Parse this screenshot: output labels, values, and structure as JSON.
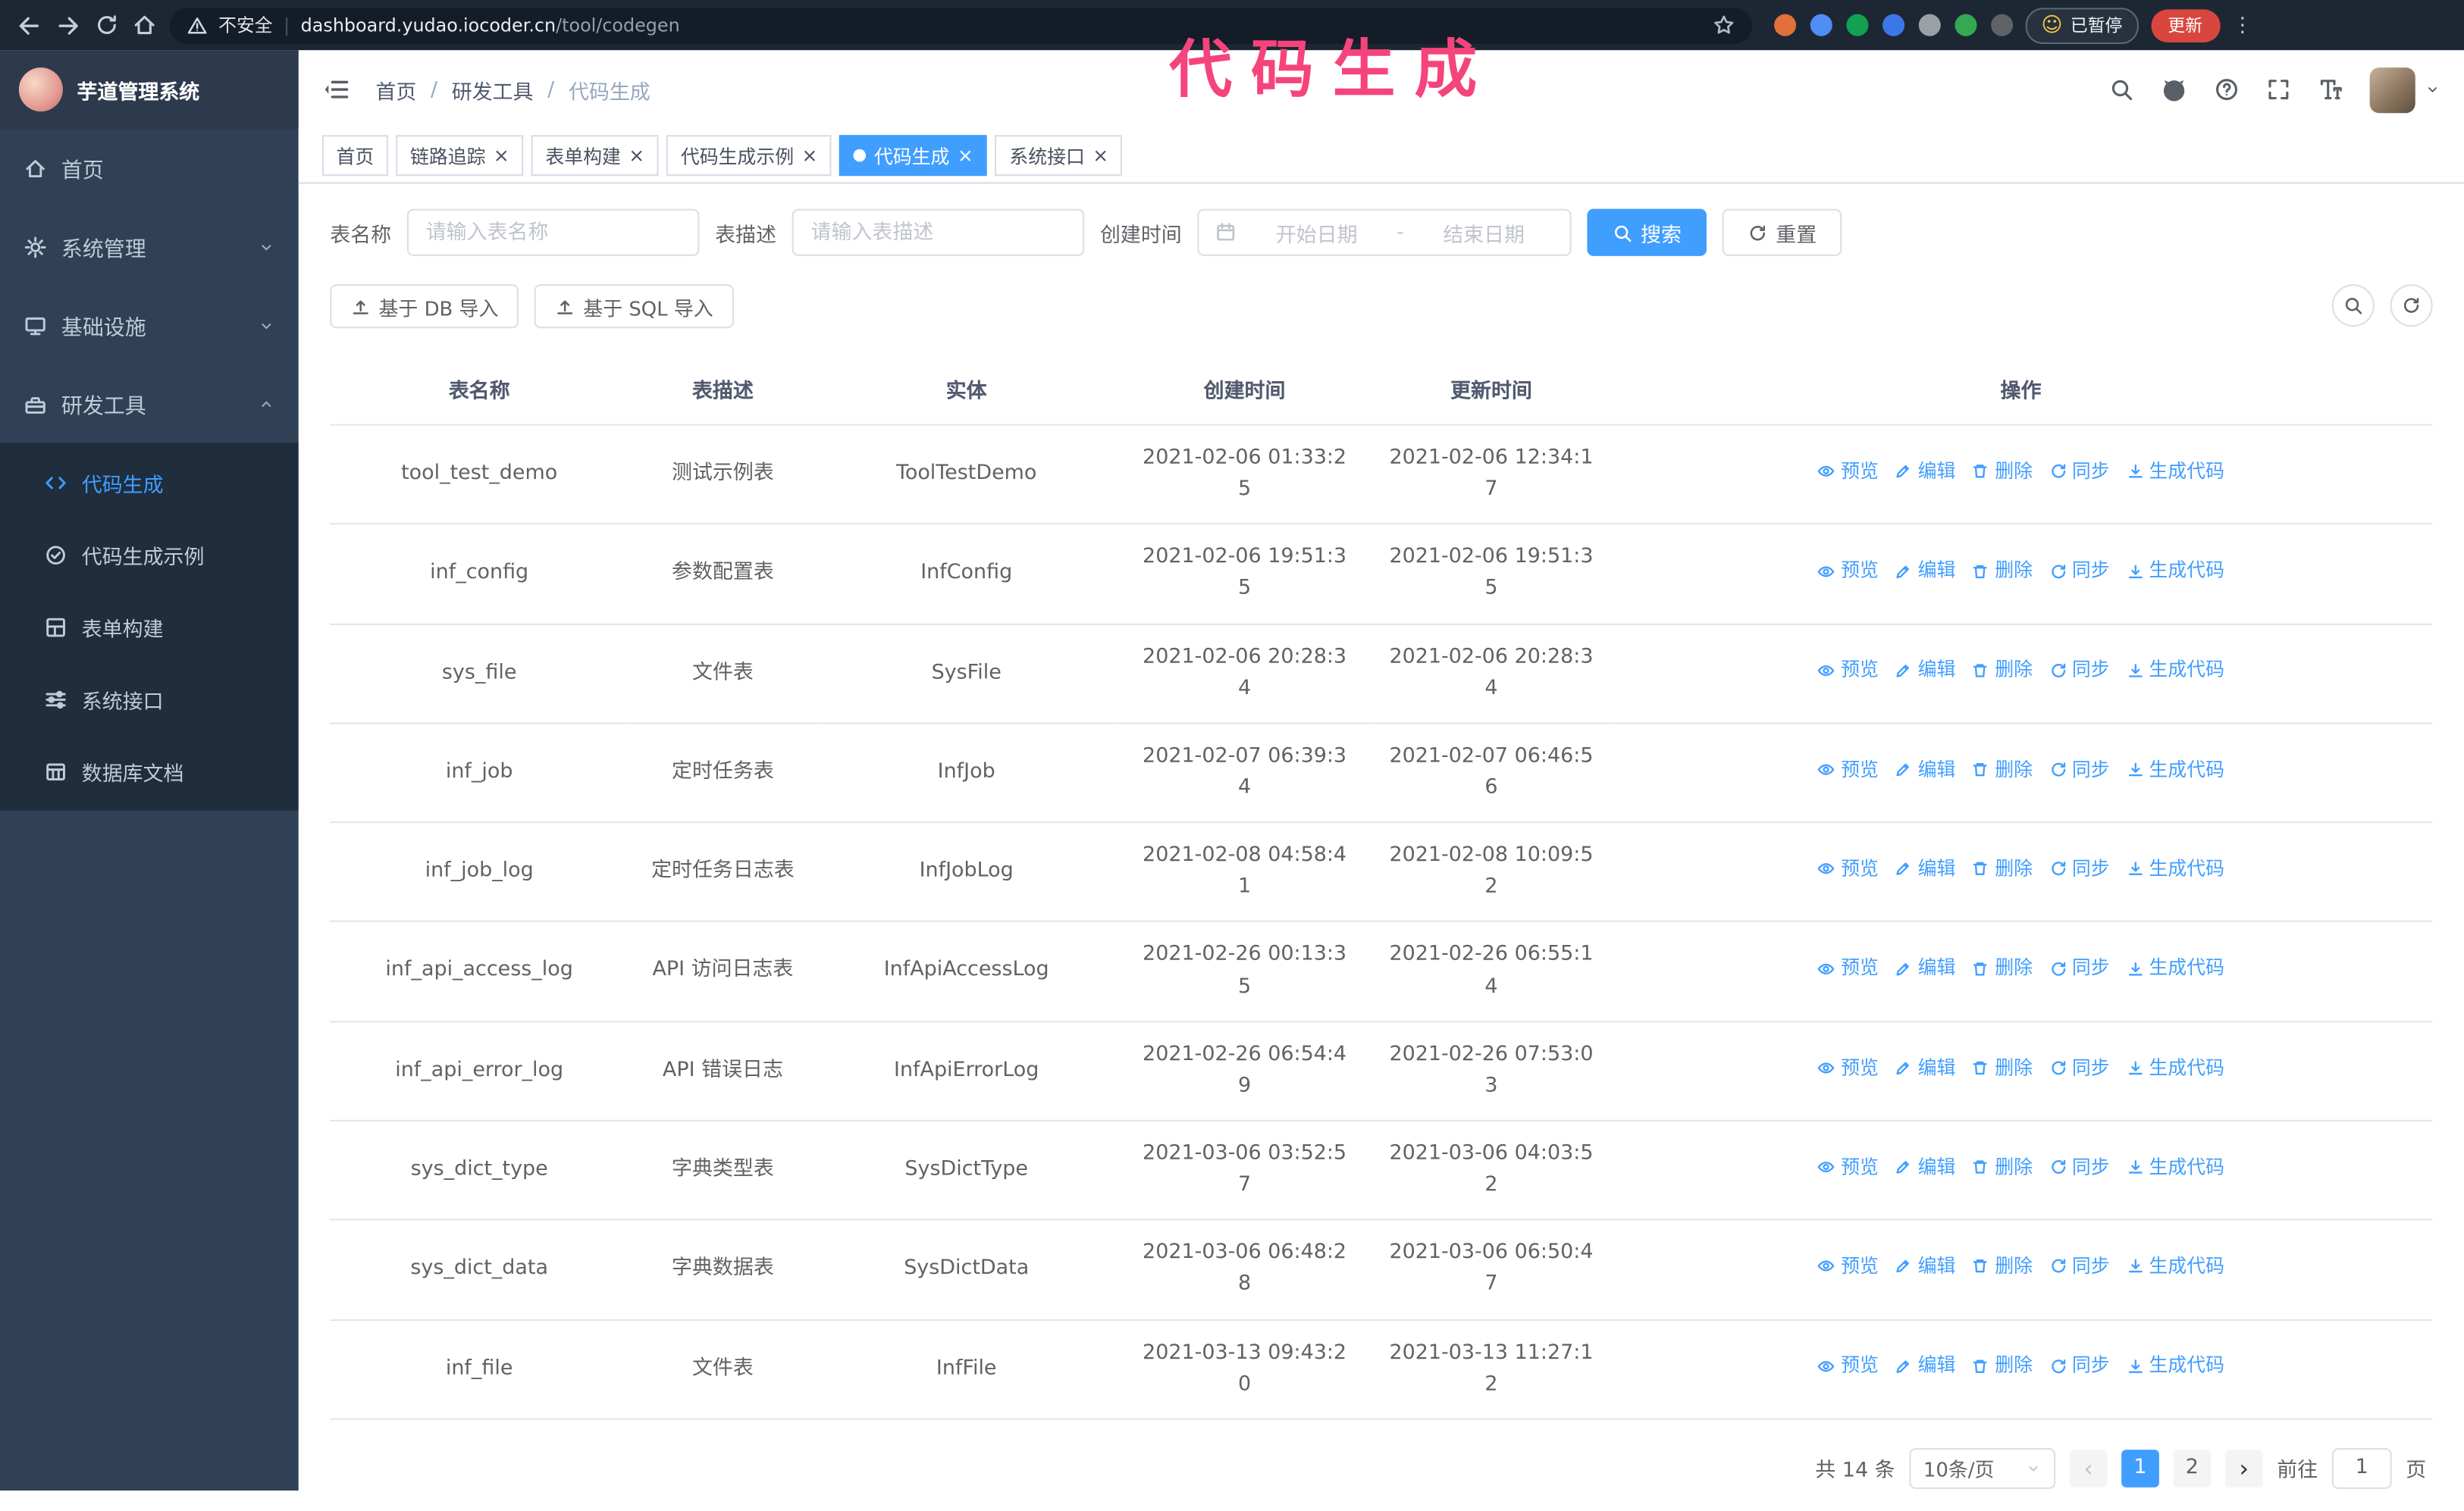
{
  "colors": {
    "accent": "#409eff",
    "annotation": "#f5447c",
    "sidebar_bg": "#304156",
    "update_button_bg": "#d9463e"
  },
  "browser": {
    "security_label": "不安全",
    "url_host": "dashboard.yudao.iocoder.cn",
    "url_path": "/tool/codegen",
    "paused_badge": "已暂停",
    "update_button": "更新",
    "extension_colors": [
      "#e2703a",
      "#4f8df7",
      "#12a150",
      "#3b78e7",
      "#9aa0a6",
      "#34a853",
      "#5f6368"
    ]
  },
  "annotation": {
    "text": "代码生成"
  },
  "app": {
    "title": "芋道管理系统",
    "breadcrumb": [
      "首页",
      "研发工具",
      "代码生成"
    ],
    "sidebar": {
      "items": [
        {
          "id": "home",
          "label": "首页",
          "icon": "home-icon"
        },
        {
          "id": "system",
          "label": "系统管理",
          "icon": "gear-icon",
          "chevron": "down"
        },
        {
          "id": "infra",
          "label": "基础设施",
          "icon": "monitor-icon",
          "chevron": "down"
        },
        {
          "id": "devtools",
          "label": "研发工具",
          "icon": "tools-icon",
          "chevron": "up",
          "children": [
            {
              "id": "codegen",
              "label": "代码生成",
              "icon": "code-icon",
              "active": true
            },
            {
              "id": "codegen-example",
              "label": "代码生成示例",
              "icon": "example-icon"
            },
            {
              "id": "form-builder",
              "label": "表单构建",
              "icon": "form-icon"
            },
            {
              "id": "api",
              "label": "系统接口",
              "icon": "api-icon"
            },
            {
              "id": "db-doc",
              "label": "数据库文档",
              "icon": "dbdoc-icon"
            }
          ]
        }
      ]
    },
    "tabs": [
      {
        "label": "首页",
        "closable": false,
        "active": false
      },
      {
        "label": "链路追踪",
        "closable": true,
        "active": false
      },
      {
        "label": "表单构建",
        "closable": true,
        "active": false
      },
      {
        "label": "代码生成示例",
        "closable": true,
        "active": false
      },
      {
        "label": "代码生成",
        "closable": true,
        "active": true
      },
      {
        "label": "系统接口",
        "closable": true,
        "active": false
      }
    ]
  },
  "filters": {
    "table_name": {
      "label": "表名称",
      "placeholder": "请输入表名称",
      "value": ""
    },
    "table_desc": {
      "label": "表描述",
      "placeholder": "请输入表描述",
      "value": ""
    },
    "create_time": {
      "label": "创建时间",
      "start_placeholder": "开始日期",
      "separator": "-",
      "end_placeholder": "结束日期"
    },
    "search_label": "搜索",
    "reset_label": "重置"
  },
  "toolbar": {
    "import_db": "基于 DB 导入",
    "import_sql": "基于 SQL 导入"
  },
  "table": {
    "columns": [
      "表名称",
      "表描述",
      "实体",
      "创建时间",
      "更新时间",
      "操作"
    ],
    "actions": [
      {
        "id": "preview",
        "label": "预览",
        "icon": "eye-icon"
      },
      {
        "id": "edit",
        "label": "编辑",
        "icon": "edit-icon"
      },
      {
        "id": "delete",
        "label": "删除",
        "icon": "delete-icon"
      },
      {
        "id": "sync",
        "label": "同步",
        "icon": "sync-icon"
      },
      {
        "id": "generate-code",
        "label": "生成代码",
        "icon": "download-icon"
      }
    ],
    "rows": [
      {
        "name": "tool_test_demo",
        "desc": "测试示例表",
        "entity": "ToolTestDemo",
        "created": "2021-02-06 01:33:25",
        "updated": "2021-02-06 12:34:17"
      },
      {
        "name": "inf_config",
        "desc": "参数配置表",
        "entity": "InfConfig",
        "created": "2021-02-06 19:51:35",
        "updated": "2021-02-06 19:51:35"
      },
      {
        "name": "sys_file",
        "desc": "文件表",
        "entity": "SysFile",
        "created": "2021-02-06 20:28:34",
        "updated": "2021-02-06 20:28:34"
      },
      {
        "name": "inf_job",
        "desc": "定时任务表",
        "entity": "InfJob",
        "created": "2021-02-07 06:39:34",
        "updated": "2021-02-07 06:46:56"
      },
      {
        "name": "inf_job_log",
        "desc": "定时任务日志表",
        "entity": "InfJobLog",
        "created": "2021-02-08 04:58:41",
        "updated": "2021-02-08 10:09:52"
      },
      {
        "name": "inf_api_access_log",
        "desc": "API 访问日志表",
        "entity": "InfApiAccessLog",
        "created": "2021-02-26 00:13:35",
        "updated": "2021-02-26 06:55:14"
      },
      {
        "name": "inf_api_error_log",
        "desc": "API 错误日志",
        "entity": "InfApiErrorLog",
        "created": "2021-02-26 06:54:49",
        "updated": "2021-02-26 07:53:03"
      },
      {
        "name": "sys_dict_type",
        "desc": "字典类型表",
        "entity": "SysDictType",
        "created": "2021-03-06 03:52:57",
        "updated": "2021-03-06 04:03:52"
      },
      {
        "name": "sys_dict_data",
        "desc": "字典数据表",
        "entity": "SysDictData",
        "created": "2021-03-06 06:48:28",
        "updated": "2021-03-06 06:50:47"
      },
      {
        "name": "inf_file",
        "desc": "文件表",
        "entity": "InfFile",
        "created": "2021-03-13 09:43:20",
        "updated": "2021-03-13 11:27:12"
      }
    ]
  },
  "pagination": {
    "total": "共 14 条",
    "page_size": "10条/页",
    "pages": [
      "1",
      "2"
    ],
    "active_page": "1",
    "goto_prefix": "前往",
    "goto_value": "1",
    "goto_suffix": "页"
  }
}
